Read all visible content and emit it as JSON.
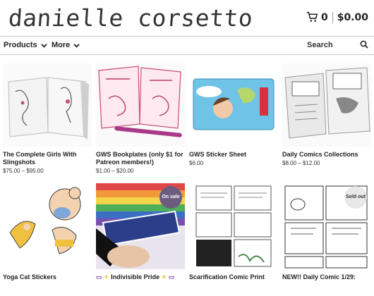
{
  "store": {
    "logo_text": "danielle corsetto",
    "cart_count": "0",
    "cart_total": "$0.00"
  },
  "nav": {
    "products_label": "Products",
    "more_label": "More",
    "search_label": "Search"
  },
  "products": [
    {
      "title": "The Complete Girls With Slingshots",
      "price": "$75.00 – $95.00"
    },
    {
      "title": "GWS Bookplates (only $1 for Patreon members!)",
      "price": "$1.00 – $20.00"
    },
    {
      "title": "GWS Sticker Sheet",
      "price": "$6.00"
    },
    {
      "title": "Daily Comics Collections",
      "price": "$8.00 – $12.00"
    },
    {
      "title": "Yoga Cat Stickers",
      "price": ""
    },
    {
      "title": "Indivisible Pride",
      "price": "",
      "badge": "On sale"
    },
    {
      "title": "Scarification Comic Print",
      "price": ""
    },
    {
      "title": "NEW!! Daily Comic 1/29:",
      "price": "",
      "badge": "Sold out"
    }
  ],
  "colors": {
    "accent": "#6b5c80",
    "rule": "#c8c8c8"
  }
}
